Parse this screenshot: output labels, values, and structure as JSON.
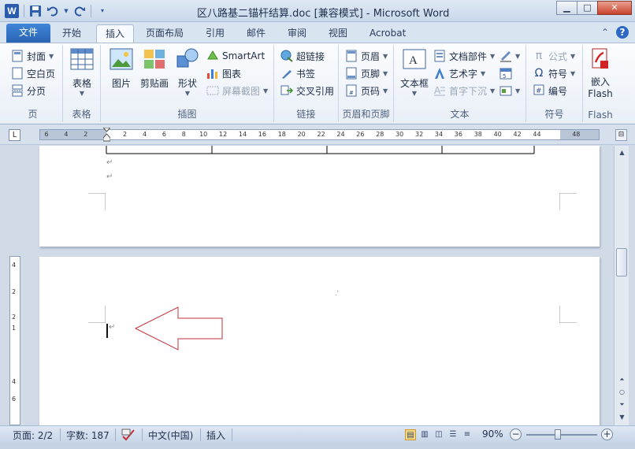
{
  "window": {
    "title": "区八路基二锚杆结算.doc [兼容模式] - Microsoft Word",
    "app_icon_letter": "W",
    "minimize": "▁",
    "maximize": "□",
    "close": "✕"
  },
  "tabs": [
    "文件",
    "开始",
    "插入",
    "页面布局",
    "引用",
    "邮件",
    "审阅",
    "视图",
    "Acrobat"
  ],
  "active_tab": "插入",
  "ribbon": {
    "pages": {
      "label": "页",
      "cover": "封面",
      "blank": "空白页",
      "break": "分页"
    },
    "tables": {
      "label": "表格",
      "table": "表格"
    },
    "illustrations": {
      "label": "插图",
      "picture": "图片",
      "clipart": "剪贴画",
      "shapes": "形状",
      "smartart": "SmartArt",
      "chart": "图表",
      "screenshot": "屏幕截图"
    },
    "links": {
      "label": "链接",
      "hyperlink": "超链接",
      "bookmark": "书签",
      "crossref": "交叉引用"
    },
    "headerfooter": {
      "label": "页眉和页脚",
      "header": "页眉",
      "footer": "页脚",
      "pagenum": "页码"
    },
    "text": {
      "label": "文本",
      "textbox": "文本框",
      "quickparts": "文档部件",
      "wordart": "艺术字",
      "dropcap": "首字下沉"
    },
    "symbols": {
      "label": "符号",
      "equation": "公式",
      "symbol": "符号",
      "number": "编号"
    },
    "flash": {
      "label": "Flash",
      "embed": "嵌入",
      "embed2": "Flash"
    }
  },
  "ruler": {
    "corner": "L",
    "ticks": [
      "6",
      "4",
      "2",
      "",
      "2",
      "4",
      "6",
      "8",
      "10",
      "12",
      "14",
      "16",
      "18",
      "20",
      "22",
      "24",
      "26",
      "28",
      "30",
      "32",
      "34",
      "36",
      "38",
      "40",
      "42",
      "44",
      "",
      "48"
    ]
  },
  "vruler_ticks": [
    "4",
    "2",
    "2",
    "1",
    "4",
    "6"
  ],
  "status": {
    "page": "页面: 2/2",
    "words": "字数: 187",
    "language": "中文(中国)",
    "mode": "插入",
    "zoom": "90%",
    "zoom_minus": "−",
    "zoom_plus": "+"
  },
  "colors": {
    "arrow": "#c0313a",
    "file_tab": "#2a63b4"
  }
}
